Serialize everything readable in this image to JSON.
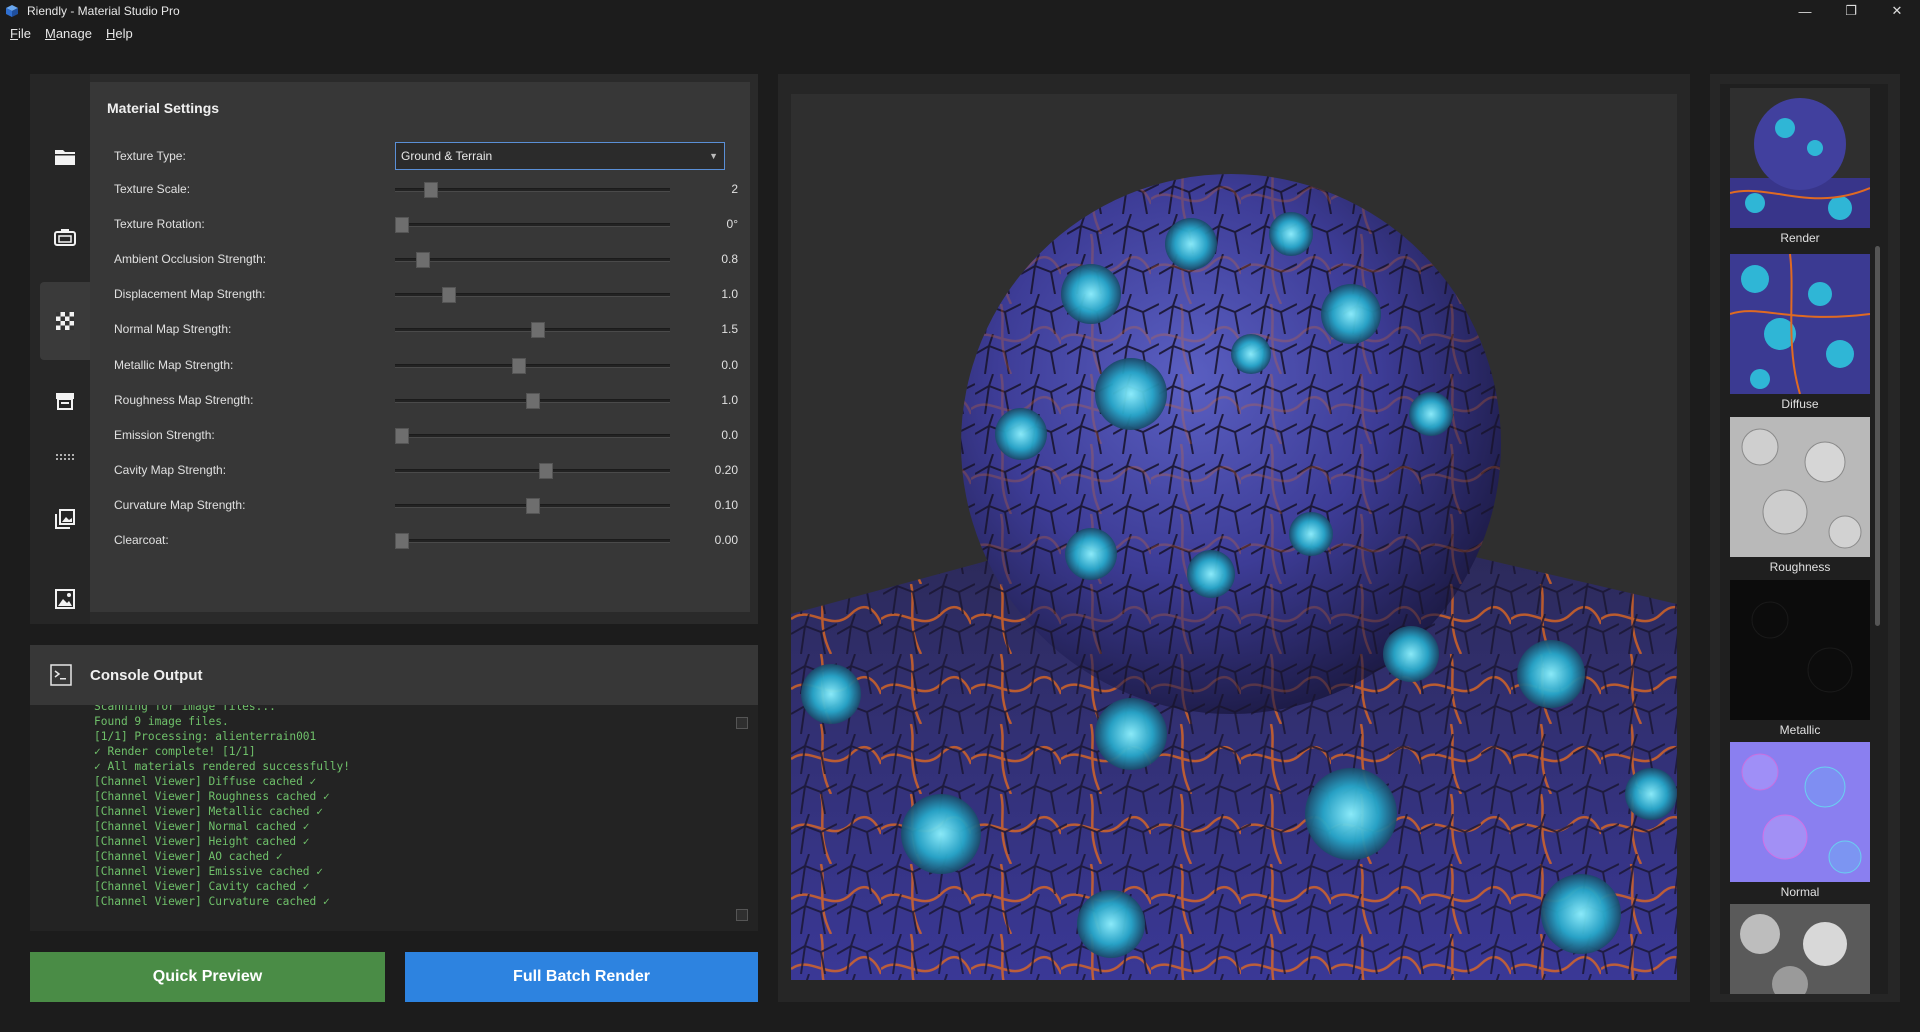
{
  "window": {
    "title": "Riendly - Material Studio Pro",
    "controls": {
      "minimize": "—",
      "maximize": "❐",
      "close": "✕"
    }
  },
  "menu": [
    {
      "label": "File",
      "accel": "F",
      "rest": "ile"
    },
    {
      "label": "Manage",
      "accel": "M",
      "rest": "anage"
    },
    {
      "label": "Help",
      "accel": "H",
      "rest": "elp"
    }
  ],
  "sidebar": {
    "icons": [
      "folder-icon",
      "camera-icon",
      "checkerboard-icon",
      "printer-icon",
      "dots-grid-icon",
      "image-stack-icon",
      "image-icon"
    ],
    "active": "checkerboard-icon"
  },
  "settings": {
    "title": "Material Settings",
    "texture_type_label": "Texture Type:",
    "texture_type_value": "Ground & Terrain",
    "sliders": [
      {
        "label": "Texture Scale:",
        "value": "2",
        "position": 0.11
      },
      {
        "label": "Texture Rotation:",
        "value": "0°",
        "position": 0.0
      },
      {
        "label": "Ambient Occlusion Strength:",
        "value": "0.8",
        "position": 0.08
      },
      {
        "label": "Displacement Map Strength:",
        "value": "1.0",
        "position": 0.18
      },
      {
        "label": "Normal Map Strength:",
        "value": "1.5",
        "position": 0.52
      },
      {
        "label": "Metallic Map Strength:",
        "value": "0.0",
        "position": 0.45
      },
      {
        "label": "Roughness Map Strength:",
        "value": "1.0",
        "position": 0.5
      },
      {
        "label": "Emission Strength:",
        "value": "0.0",
        "position": 0.0
      },
      {
        "label": "Cavity Map Strength:",
        "value": "0.20",
        "position": 0.55
      },
      {
        "label": "Curvature Map Strength:",
        "value": "0.10",
        "position": 0.5
      },
      {
        "label": "Clearcoat:",
        "value": "0.00",
        "position": 0.0
      }
    ]
  },
  "console": {
    "title": "Console Output",
    "lines": [
      "Scanning for image files...",
      "Found 9 image files.",
      "[1/1] Processing: alienterrain001",
      "✓ Render complete! [1/1]",
      "✓ All materials rendered successfully!",
      "[Channel Viewer] Diffuse cached ✓",
      "[Channel Viewer] Roughness cached ✓",
      "[Channel Viewer] Metallic cached ✓",
      "[Channel Viewer] Normal cached ✓",
      "[Channel Viewer] Height cached ✓",
      "[Channel Viewer] AO cached ✓",
      "[Channel Viewer] Emissive cached ✓",
      "[Channel Viewer] Cavity cached ✓",
      "[Channel Viewer] Curvature cached ✓"
    ]
  },
  "buttons": {
    "quick_preview": "Quick Preview",
    "batch_render": "Full Batch Render"
  },
  "channels": [
    {
      "label": "Render"
    },
    {
      "label": "Diffuse"
    },
    {
      "label": "Roughness"
    },
    {
      "label": "Metallic"
    },
    {
      "label": "Normal"
    },
    {
      "label": ""
    }
  ],
  "colors": {
    "accent_green": "#4a8c46",
    "accent_blue": "#2d83e0",
    "console_text": "#6fc06a"
  }
}
